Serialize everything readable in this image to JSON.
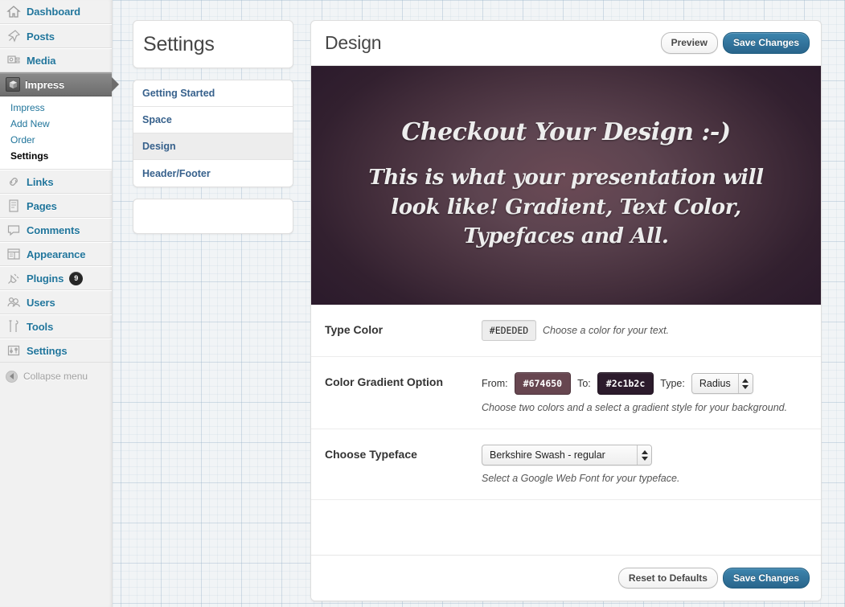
{
  "admin_menu": {
    "items": [
      {
        "label": "Dashboard",
        "icon": "dashboard-icon",
        "state": "normal"
      },
      {
        "label": "Posts",
        "icon": "pin-icon",
        "state": "normal"
      },
      {
        "label": "Media",
        "icon": "media-icon",
        "state": "normal"
      },
      {
        "label": "Impress",
        "icon": "impress-cube-icon",
        "state": "current"
      },
      {
        "label": "Links",
        "icon": "link-icon",
        "state": "normal"
      },
      {
        "label": "Pages",
        "icon": "pages-icon",
        "state": "normal"
      },
      {
        "label": "Comments",
        "icon": "comment-bubble-icon",
        "state": "normal"
      },
      {
        "label": "Appearance",
        "icon": "appearance-icon",
        "state": "normal"
      },
      {
        "label": "Plugins",
        "icon": "plug-icon",
        "state": "normal",
        "badge": "9"
      },
      {
        "label": "Users",
        "icon": "users-icon",
        "state": "normal"
      },
      {
        "label": "Tools",
        "icon": "tools-icon",
        "state": "normal"
      },
      {
        "label": "Settings",
        "icon": "settings-sliders-icon",
        "state": "normal"
      }
    ],
    "submenu": [
      {
        "label": "Impress",
        "current": false
      },
      {
        "label": "Add New",
        "current": false
      },
      {
        "label": "Order",
        "current": false
      },
      {
        "label": "Settings",
        "current": true
      }
    ],
    "collapse": {
      "label": "Collapse menu",
      "icon": "collapse-arrow-icon"
    }
  },
  "settings_nav": {
    "title": "Settings",
    "items": [
      {
        "label": "Getting Started",
        "active": false
      },
      {
        "label": "Space",
        "active": false
      },
      {
        "label": "Design",
        "active": true
      },
      {
        "label": "Header/Footer",
        "active": false
      }
    ]
  },
  "design_panel": {
    "title": "Design",
    "header_buttons": {
      "preview": "Preview",
      "save": "Save Changes"
    },
    "preview": {
      "heading": "Checkout Your Design :-)",
      "body": "This is what your presentation will look like! Gradient, Text Color, Typefaces and All.",
      "text_color": "#ededed",
      "gradient_from": "#674650",
      "gradient_to": "#2c1b2c",
      "gradient_type": "Radius"
    },
    "fields": {
      "type_color": {
        "label": "Type Color",
        "value": "#EDEDED",
        "hint": "Choose a color for your text."
      },
      "gradient": {
        "label": "Color Gradient Option",
        "from_label": "From:",
        "from_value": "#674650",
        "to_label": "To:",
        "to_value": "#2c1b2c",
        "type_label": "Type:",
        "type_value": "Radius",
        "hint": "Choose two colors and a select a gradient style for your background."
      },
      "typeface": {
        "label": "Choose Typeface",
        "value": "Berkshire Swash - regular",
        "hint": "Select a Google Web Font for your typeface."
      }
    },
    "footer_buttons": {
      "reset": "Reset to Defaults",
      "save": "Save Changes"
    }
  },
  "colors": {
    "wp_blue": "#21759b",
    "nav_blue": "#37618c",
    "primary_button": "#29658c",
    "current_menu": "#6d6d6d"
  }
}
